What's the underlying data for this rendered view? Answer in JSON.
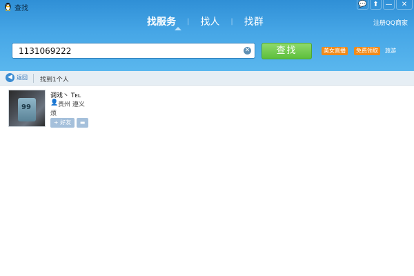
{
  "window": {
    "title": "查找",
    "controls": [
      "feedback-icon",
      "share-icon",
      "minimize-icon",
      "close-icon"
    ],
    "control_glyphs": [
      "💬",
      "⬆",
      "—",
      "✕"
    ]
  },
  "tabs": [
    {
      "label": "找服务",
      "active": true
    },
    {
      "label": "找人",
      "active": false
    },
    {
      "label": "找群",
      "active": false
    }
  ],
  "tab_separator": "|",
  "header": {
    "merchant_link": "注册QQ商家"
  },
  "search": {
    "value": "1131069222",
    "button_label": "查找"
  },
  "tags": [
    "美女直播",
    "免费领取"
  ],
  "ad_link": "旅游",
  "toolbar": {
    "back_label": "返回",
    "result_count": "找到1个人"
  },
  "results": [
    {
      "avatar_text": "99",
      "nickname": "调戏丶 Tᴇʟ",
      "location": "贵州 遵义",
      "bio": "烦",
      "add_friend_label": "+ 好友",
      "chat_icon": "message-icon"
    }
  ],
  "colors": {
    "header_blue": "#46a6e6",
    "search_green": "#5dbf3c",
    "tag_orange": "#f08a1a"
  }
}
